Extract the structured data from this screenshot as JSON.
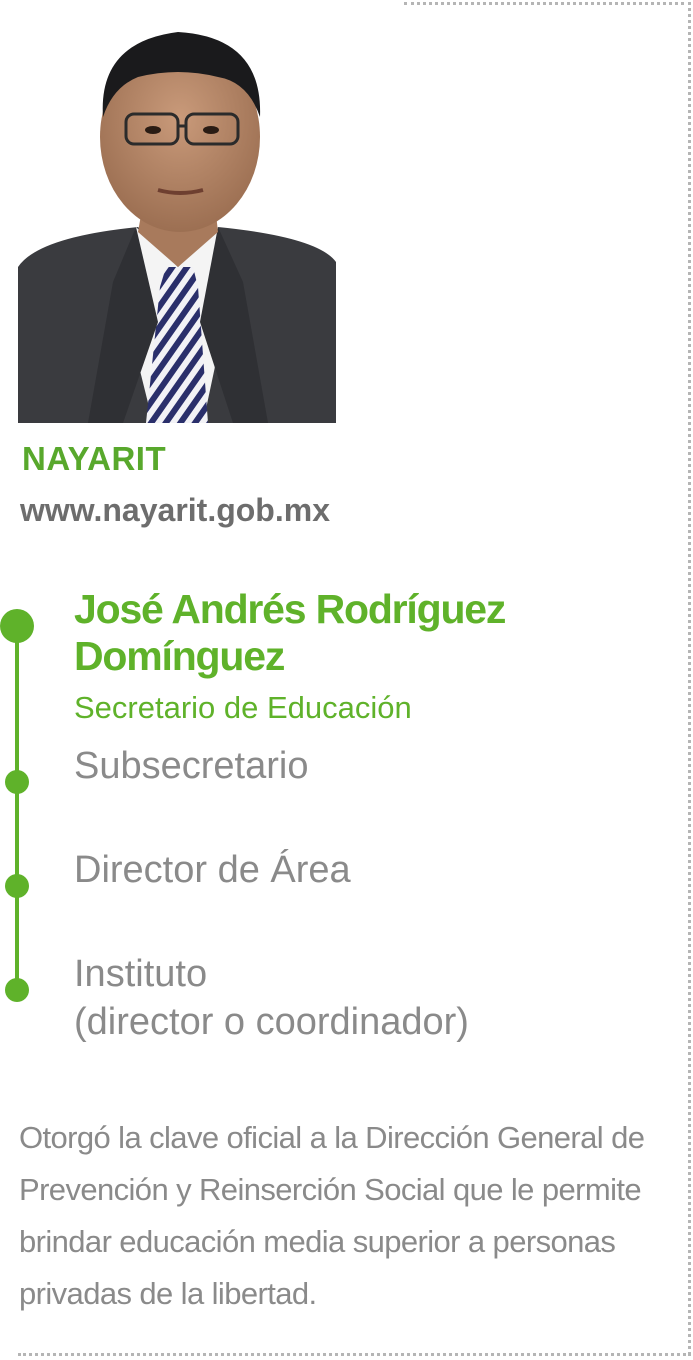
{
  "profile": {
    "state": "NAYARIT",
    "website": "www.nayarit.gob.mx",
    "name_line1": "José Andrés Rodríguez",
    "name_line2": "Domínguez",
    "position": "Secretario de Educación",
    "description": "Otorgó la clave oficial a la Dirección General de Prevención y Reinserción Social que le permite brindar educación media superior a personas privadas de la libertad."
  },
  "levels": {
    "subsecretario": "Subsecretario",
    "director_area": "Director de Área",
    "instituto_line1": "Instituto",
    "instituto_line2": "(director o coordinador)"
  },
  "colors": {
    "accent_green": "#5fb22a",
    "text_gray": "#8a8a8a",
    "border_gray": "#b5b5b5"
  }
}
